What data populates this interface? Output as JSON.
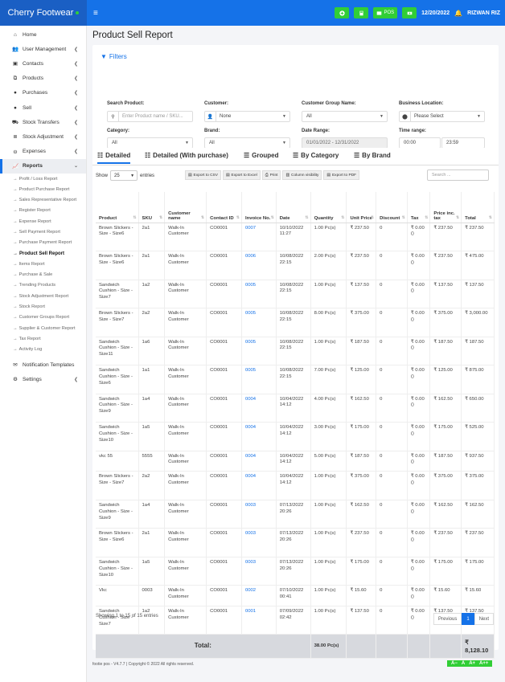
{
  "header": {
    "brand": "Cherry Footwear",
    "menu_icon": "bars-icon",
    "pos_label": "POS",
    "date": "12/20/2022",
    "user": "RIZWAN RIZ"
  },
  "sidebar": {
    "items": [
      {
        "label": "Home",
        "icon": "home-icon"
      },
      {
        "label": "User Management",
        "icon": "users-icon"
      },
      {
        "label": "Contacts",
        "icon": "contacts-icon"
      },
      {
        "label": "Products",
        "icon": "cubes-icon"
      },
      {
        "label": "Purchases",
        "icon": "purchase-icon"
      },
      {
        "label": "Sell",
        "icon": "sell-icon"
      },
      {
        "label": "Stock Transfers",
        "icon": "truck-icon"
      },
      {
        "label": "Stock Adjustment",
        "icon": "database-icon"
      },
      {
        "label": "Expenses",
        "icon": "minus-circle-icon"
      },
      {
        "label": "Reports",
        "icon": "chart-icon"
      }
    ],
    "report_items": [
      "Profit / Loss Report",
      "Product Purchase Report",
      "Sales Representative Report",
      "Register Report",
      "Expense Report",
      "Sell Payment Report",
      "Purchase Payment Report",
      "Product Sell Report",
      "Items Report",
      "Purchase & Sale",
      "Trending Products",
      "Stock Adjustment Report",
      "Stock Report",
      "Customer Groups Report",
      "Supplier & Customer Report",
      "Tax Report",
      "Activity Log"
    ],
    "bottom": [
      {
        "label": "Notification Templates",
        "icon": "envelope-icon"
      },
      {
        "label": "Settings",
        "icon": "gear-icon"
      }
    ]
  },
  "page": {
    "title": "Product Sell Report"
  },
  "filters": {
    "title": "Filters",
    "search_product_label": "Search Product:",
    "search_product_placeholder": "Enter Product name / SKU...",
    "customer_label": "Customer:",
    "customer_value": "None",
    "customer_group_label": "Customer Group Name:",
    "customer_group_value": "All",
    "business_location_label": "Business Location:",
    "business_location_value": "Please Select",
    "category_label": "Category:",
    "category_value": "All",
    "brand_label": "Brand:",
    "brand_value": "All",
    "date_range_label": "Date Range:",
    "date_range_value": "01/01/2022 - 12/31/2022",
    "time_range_label": "Time range:",
    "time_from": "00:00",
    "time_to": "23:59"
  },
  "tabs": [
    "Detailed",
    "Detailed (With purchase)",
    "Grouped",
    "By Category",
    "By Brand"
  ],
  "table_controls": {
    "show_label": "Show",
    "show_value": "25",
    "entries_label": "entries",
    "export_buttons": [
      "Export to CSV",
      "Export to Excel",
      "Print",
      "Column visibility",
      "Export to PDF"
    ],
    "search_placeholder": "Search ..."
  },
  "table": {
    "columns": [
      "Product",
      "SKU",
      "Customer name",
      "Contact ID",
      "Invoice No.",
      "Date",
      "Quantity",
      "Unit Price",
      "Discount",
      "Tax",
      "Price inc. tax",
      "Total"
    ],
    "rows": [
      [
        "Brown Slickers - Size - Size6",
        "2a1",
        "Walk-In Customer",
        "CO0001",
        "0007",
        "10/10/2022 11:27",
        "1.00 Pc(s)",
        "₹ 237.50",
        "0",
        "₹ 0.00 ()",
        "₹ 237.50",
        "₹ 237.50"
      ],
      [
        "Brown Slickers - Size - Size6",
        "2a1",
        "Walk-In Customer",
        "CO0001",
        "0006",
        "10/08/2022 22:15",
        "2.00 Pc(s)",
        "₹ 237.50",
        "0",
        "₹ 0.00 ()",
        "₹ 237.50",
        "₹ 475.00"
      ],
      [
        "Sandwich Cushion - Size - Size7",
        "1a2",
        "Walk-In Customer",
        "CO0001",
        "0005",
        "10/08/2022 22:15",
        "1.00 Pc(s)",
        "₹ 137.50",
        "0",
        "₹ 0.00 ()",
        "₹ 137.50",
        "₹ 137.50"
      ],
      [
        "Brown Slickers - Size - Size7",
        "2a2",
        "Walk-In Customer",
        "CO0001",
        "0005",
        "10/08/2022 22:15",
        "8.00 Pc(s)",
        "₹ 375.00",
        "0",
        "₹ 0.00 ()",
        "₹ 375.00",
        "₹ 3,000.00"
      ],
      [
        "Sandwich Cushion - Size - Size11",
        "1a6",
        "Walk-In Customer",
        "CO0001",
        "0005",
        "10/08/2022 22:15",
        "1.00 Pc(s)",
        "₹ 187.50",
        "0",
        "₹ 0.00 ()",
        "₹ 187.50",
        "₹ 187.50"
      ],
      [
        "Sandwich Cushion - Size - Size6",
        "1a1",
        "Walk-In Customer",
        "CO0001",
        "0005",
        "10/08/2022 22:15",
        "7.00 Pc(s)",
        "₹ 125.00",
        "0",
        "₹ 0.00 ()",
        "₹ 125.00",
        "₹ 875.00"
      ],
      [
        "Sandwich Cushion - Size - Size9",
        "1a4",
        "Walk-In Customer",
        "CO0001",
        "0004",
        "10/04/2022 14:12",
        "4.00 Pc(s)",
        "₹ 162.50",
        "0",
        "₹ 0.00 ()",
        "₹ 162.50",
        "₹ 650.00"
      ],
      [
        "Sandwich Cushion - Size - Size10",
        "1a5",
        "Walk-In Customer",
        "CO0001",
        "0004",
        "10/04/2022 14:12",
        "3.00 Pc(s)",
        "₹ 175.00",
        "0",
        "₹ 0.00 ()",
        "₹ 175.00",
        "₹ 525.00"
      ],
      [
        "vkc 55",
        "5555",
        "Walk-In Customer",
        "CO0001",
        "0004",
        "10/04/2022 14:12",
        "5.00 Pc(s)",
        "₹ 187.50",
        "0",
        "₹ 0.00 ()",
        "₹ 187.50",
        "₹ 937.50"
      ],
      [
        "Brown Slickers - Size - Size7",
        "2a2",
        "Walk-In Customer",
        "CO0001",
        "0004",
        "10/04/2022 14:12",
        "1.00 Pc(s)",
        "₹ 375.00",
        "0",
        "₹ 0.00 ()",
        "₹ 375.00",
        "₹ 375.00"
      ],
      [
        "Sandwich Cushion - Size - Size9",
        "1a4",
        "Walk-In Customer",
        "CO0001",
        "0003",
        "07/13/2022 20:26",
        "1.00 Pc(s)",
        "₹ 162.50",
        "0",
        "₹ 0.00 ()",
        "₹ 162.50",
        "₹ 162.50"
      ],
      [
        "Brown Slickers - Size - Size6",
        "2a1",
        "Walk-In Customer",
        "CO0001",
        "0003",
        "07/13/2022 20:26",
        "1.00 Pc(s)",
        "₹ 237.50",
        "0",
        "₹ 0.00 ()",
        "₹ 237.50",
        "₹ 237.50"
      ],
      [
        "Sandwich Cushion - Size - Size10",
        "1a5",
        "Walk-In Customer",
        "CO0001",
        "0003",
        "07/13/2022 20:26",
        "1.00 Pc(s)",
        "₹ 175.00",
        "0",
        "₹ 0.00 ()",
        "₹ 175.00",
        "₹ 175.00"
      ],
      [
        "Vkc",
        "0003",
        "Walk-In Customer",
        "CO0001",
        "0002",
        "07/10/2022 00:41",
        "1.00 Pc(s)",
        "₹ 15.60",
        "0",
        "₹ 0.00 ()",
        "₹ 15.60",
        "₹ 15.60"
      ],
      [
        "Sandwich Cushion - Size - Size7",
        "1a2",
        "Walk-In Customer",
        "CO0001",
        "0001",
        "07/09/2022 02:42",
        "1.00 Pc(s)",
        "₹ 137.50",
        "0",
        "₹ 0.00 ()",
        "₹ 137.50",
        "₹ 137.50"
      ]
    ],
    "total_label": "Total:",
    "total_quantity": "38.00 Pc(s)",
    "total_amount": "₹ 8,128.10"
  },
  "pagination": {
    "showing": "Showing 1 to 15 of 15 entries",
    "previous": "Previous",
    "current": "1",
    "next": "Next"
  },
  "footer": {
    "text": "footie pos - V4.7.7 | Copyright © 2022 All rights reserved.",
    "font_buttons": [
      "A−",
      "A",
      "A+",
      "A++"
    ]
  }
}
